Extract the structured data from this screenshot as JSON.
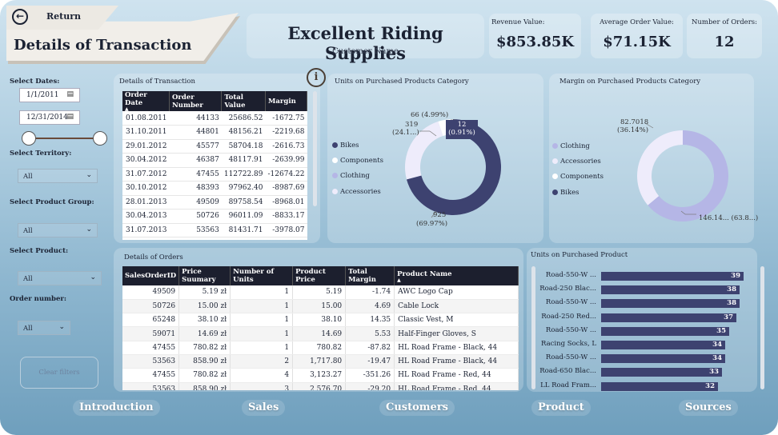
{
  "header": {
    "return_label": "Return",
    "page_title": "Details of Transaction",
    "company": "Excellent Riding Supplies",
    "customer_name": "Customer Name"
  },
  "kpis": [
    {
      "label": "Revenue Value:",
      "value": "$853.85K"
    },
    {
      "label": "Average Order Value:",
      "value": "$71.15K"
    },
    {
      "label": "Number of Orders:",
      "value": "12"
    }
  ],
  "filters": {
    "dates_label": "Select Dates:",
    "date_start": "1/1/2011",
    "date_end": "12/31/2014",
    "territory_label": "Select Territory:",
    "territory_value": "All",
    "product_group_label": "Select Product Group:",
    "product_group_value": "All",
    "product_label": "Select Product:",
    "product_value": "All",
    "order_number_label": "Order number:",
    "order_number_value": "All",
    "clear_label": "Clear filters"
  },
  "transactions": {
    "title": "Details of Transaction",
    "columns": [
      "Order Date",
      "Order Number",
      "Total Value",
      "Margin"
    ],
    "rows": [
      [
        "01.08.2011",
        "44133",
        "25686.52",
        "-1672.75"
      ],
      [
        "31.10.2011",
        "44801",
        "48156.21",
        "-2219.68"
      ],
      [
        "29.01.2012",
        "45577",
        "58704.18",
        "-2616.73"
      ],
      [
        "30.04.2012",
        "46387",
        "48117.91",
        "-2639.99"
      ],
      [
        "31.07.2012",
        "47455",
        "112722.89",
        "-12674.22"
      ],
      [
        "30.10.2012",
        "48393",
        "97962.40",
        "-8987.69"
      ],
      [
        "28.01.2013",
        "49509",
        "89758.54",
        "-8968.01"
      ],
      [
        "30.04.2013",
        "50726",
        "96011.09",
        "-8833.17"
      ],
      [
        "31.07.2013",
        "53563",
        "81431.71",
        "-3978.07"
      ]
    ]
  },
  "units_category": {
    "title": "Units on Purchased Products Category",
    "legend": [
      "Bikes",
      "Components",
      "Clothing",
      "Accessories"
    ],
    "labels": {
      "components": "66 (4.99%)",
      "clothing_value": "319",
      "clothing_pct": "(24.1...)",
      "tooltip_value": "12",
      "tooltip_pct": "(0.91%)",
      "bikes_value": "925",
      "bikes_pct": "(69.97%)"
    }
  },
  "margin_category": {
    "title": "Margin on Purchased Products Category",
    "legend": [
      "Clothing",
      "Accessories",
      "Components",
      "Bikes"
    ],
    "labels": {
      "clothing_value": "82.7018",
      "clothing_pct": "(36.14%)",
      "bikes": "146.14... (63.8...)"
    }
  },
  "orders": {
    "title": "Details of Orders",
    "columns": [
      "SalesOrderID",
      "Price Suumary",
      "Number of Units",
      "Product Price",
      "Total Margin",
      "Product Name"
    ],
    "rows": [
      [
        "49509",
        "5.19 zł",
        "1",
        "5.19",
        "-1.74",
        "AWC Logo Cap"
      ],
      [
        "50726",
        "15.00 zł",
        "1",
        "15.00",
        "4.69",
        "Cable Lock"
      ],
      [
        "65248",
        "38.10 zł",
        "1",
        "38.10",
        "14.35",
        "Classic Vest, M"
      ],
      [
        "59071",
        "14.69 zł",
        "1",
        "14.69",
        "5.53",
        "Half-Finger Gloves, S"
      ],
      [
        "47455",
        "780.82 zł",
        "1",
        "780.82",
        "-87.82",
        "HL Road Frame - Black, 44"
      ],
      [
        "53563",
        "858.90 zł",
        "2",
        "1,717.80",
        "-19.47",
        "HL Road Frame - Black, 44"
      ],
      [
        "47455",
        "780.82 zł",
        "4",
        "3,123.27",
        "-351.26",
        "HL Road Frame - Red, 44"
      ],
      [
        "53563",
        "858.90 zł",
        "3",
        "2,576.70",
        "-29.20",
        "HL Road Frame - Red, 44"
      ]
    ]
  },
  "units_product": {
    "title": "Units on Purchased Product",
    "bars": [
      {
        "label": "Road-550-W ...",
        "value": 39
      },
      {
        "label": "Road-250 Blac...",
        "value": 38
      },
      {
        "label": "Road-550-W ...",
        "value": 38
      },
      {
        "label": "Road-250 Red...",
        "value": 37
      },
      {
        "label": "Road-550-W ...",
        "value": 35
      },
      {
        "label": "Racing Socks, L",
        "value": 34
      },
      {
        "label": "Road-550-W ...",
        "value": 34
      },
      {
        "label": "Road-650 Blac...",
        "value": 33
      },
      {
        "label": "LL Road Fram...",
        "value": 32
      }
    ]
  },
  "nav": [
    "Introduction",
    "Sales",
    "Customers",
    "Product",
    "Sources"
  ],
  "colors": {
    "dark": "#3d4270",
    "light": "#eeecfb",
    "mid": "#b5b6e6",
    "header_dark": "#1c1f2e"
  }
}
